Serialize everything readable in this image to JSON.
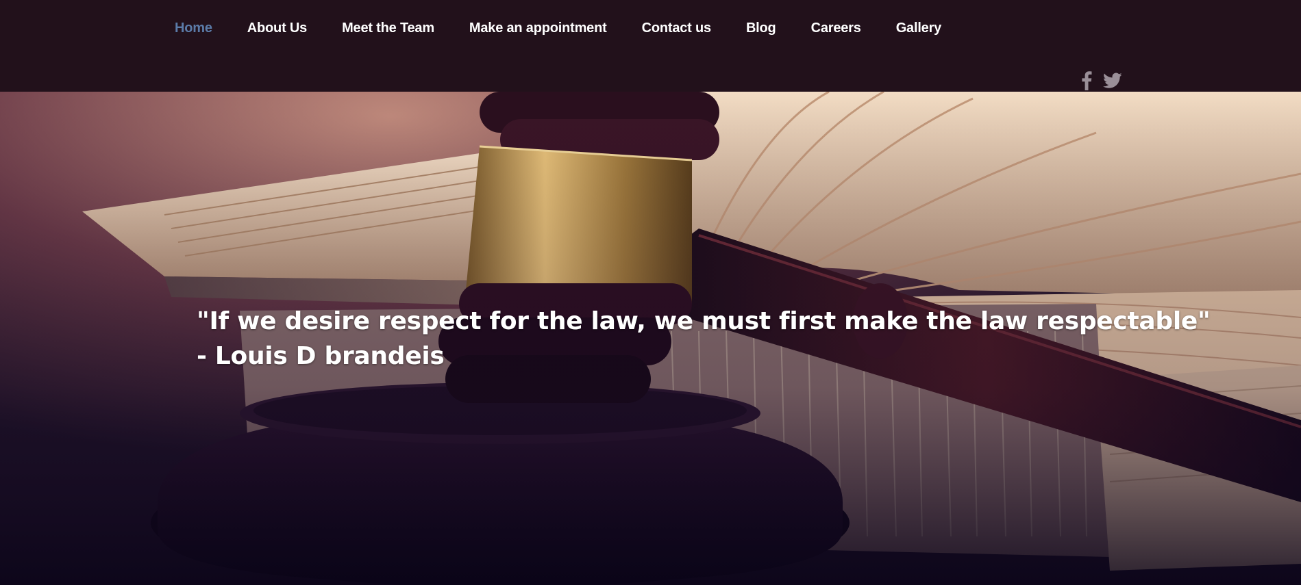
{
  "nav": {
    "items": [
      {
        "label": "Home",
        "active": true
      },
      {
        "label": "About Us",
        "active": false
      },
      {
        "label": "Meet the Team",
        "active": false
      },
      {
        "label": "Make an appointment",
        "active": false
      },
      {
        "label": "Contact us",
        "active": false
      },
      {
        "label": "Blog",
        "active": false
      },
      {
        "label": "Careers",
        "active": false
      },
      {
        "label": "Gallery",
        "active": false
      }
    ]
  },
  "social": {
    "icons": [
      "facebook-icon",
      "twitter-icon"
    ],
    "color": "#9a8f98"
  },
  "hero": {
    "quote_line1": "\"If we desire respect for the law, we must first make the law respectable\"",
    "quote_line2": "- Louis D brandeis"
  },
  "colors": {
    "header_bg": "#22111b",
    "nav_text": "#ffffff",
    "nav_active": "#5b7ba8"
  }
}
